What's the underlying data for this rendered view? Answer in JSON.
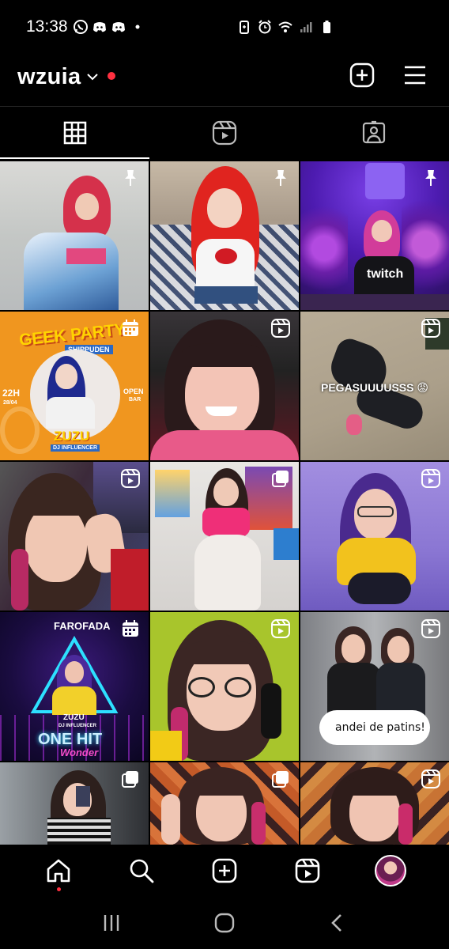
{
  "status_bar": {
    "time": "13:38",
    "left_icons": [
      "whatsapp-icon",
      "discord-icon",
      "discord-icon",
      "dot-icon"
    ],
    "right_icons": [
      "battery-saver-icon",
      "alarm-icon",
      "wifi-icon",
      "signal-icon",
      "battery-icon"
    ]
  },
  "header": {
    "username": "wzuia",
    "notification_color": "#ff3040"
  },
  "tabs": [
    {
      "name": "posts",
      "icon": "grid-icon",
      "active": true
    },
    {
      "name": "reels",
      "icon": "reels-icon",
      "active": false
    },
    {
      "name": "tagged",
      "icon": "tagged-icon",
      "active": false
    }
  ],
  "grid": {
    "tiles": [
      {
        "badge": "pin-icon"
      },
      {
        "badge": "pin-icon"
      },
      {
        "badge": "pin-icon",
        "text_1": "twitch"
      },
      {
        "badge": "carousel-icon",
        "text_1": "GEEK PARTY",
        "text_2": "SHIPPUDEN",
        "text_3": "22H",
        "text_4": "28/04",
        "text_5": "OPEN",
        "text_6": "BAR",
        "text_7": "ZUZU",
        "text_8": "DJ INFLUENCER"
      },
      {
        "badge": "reel-icon"
      },
      {
        "badge": "reel-icon",
        "text_1": "PEGASUUUUSSS 😡"
      },
      {
        "badge": "reel-icon"
      },
      {
        "badge": "carousel-icon"
      },
      {
        "badge": "reel-icon"
      },
      {
        "badge": "carousel-icon",
        "text_1": "FAROFADA",
        "text_2": "ZUZU",
        "text_3": "DJ INFLUENCER",
        "text_4": "ONE HIT",
        "text_5": "Wonder"
      },
      {
        "badge": "reel-icon"
      },
      {
        "badge": "reel-icon",
        "text_1": "andei de patins!"
      },
      {
        "badge": "carousel-icon"
      },
      {
        "badge": "carousel-icon"
      },
      {
        "badge": "reel-icon"
      }
    ]
  },
  "bottom_nav": [
    {
      "name": "home",
      "icon": "home-icon",
      "active": true
    },
    {
      "name": "search",
      "icon": "search-icon"
    },
    {
      "name": "create",
      "icon": "plus-square-icon"
    },
    {
      "name": "reels",
      "icon": "reels-icon"
    },
    {
      "name": "profile",
      "icon": "avatar"
    }
  ],
  "system_nav": [
    "recents-icon",
    "home-button-icon",
    "back-icon"
  ]
}
